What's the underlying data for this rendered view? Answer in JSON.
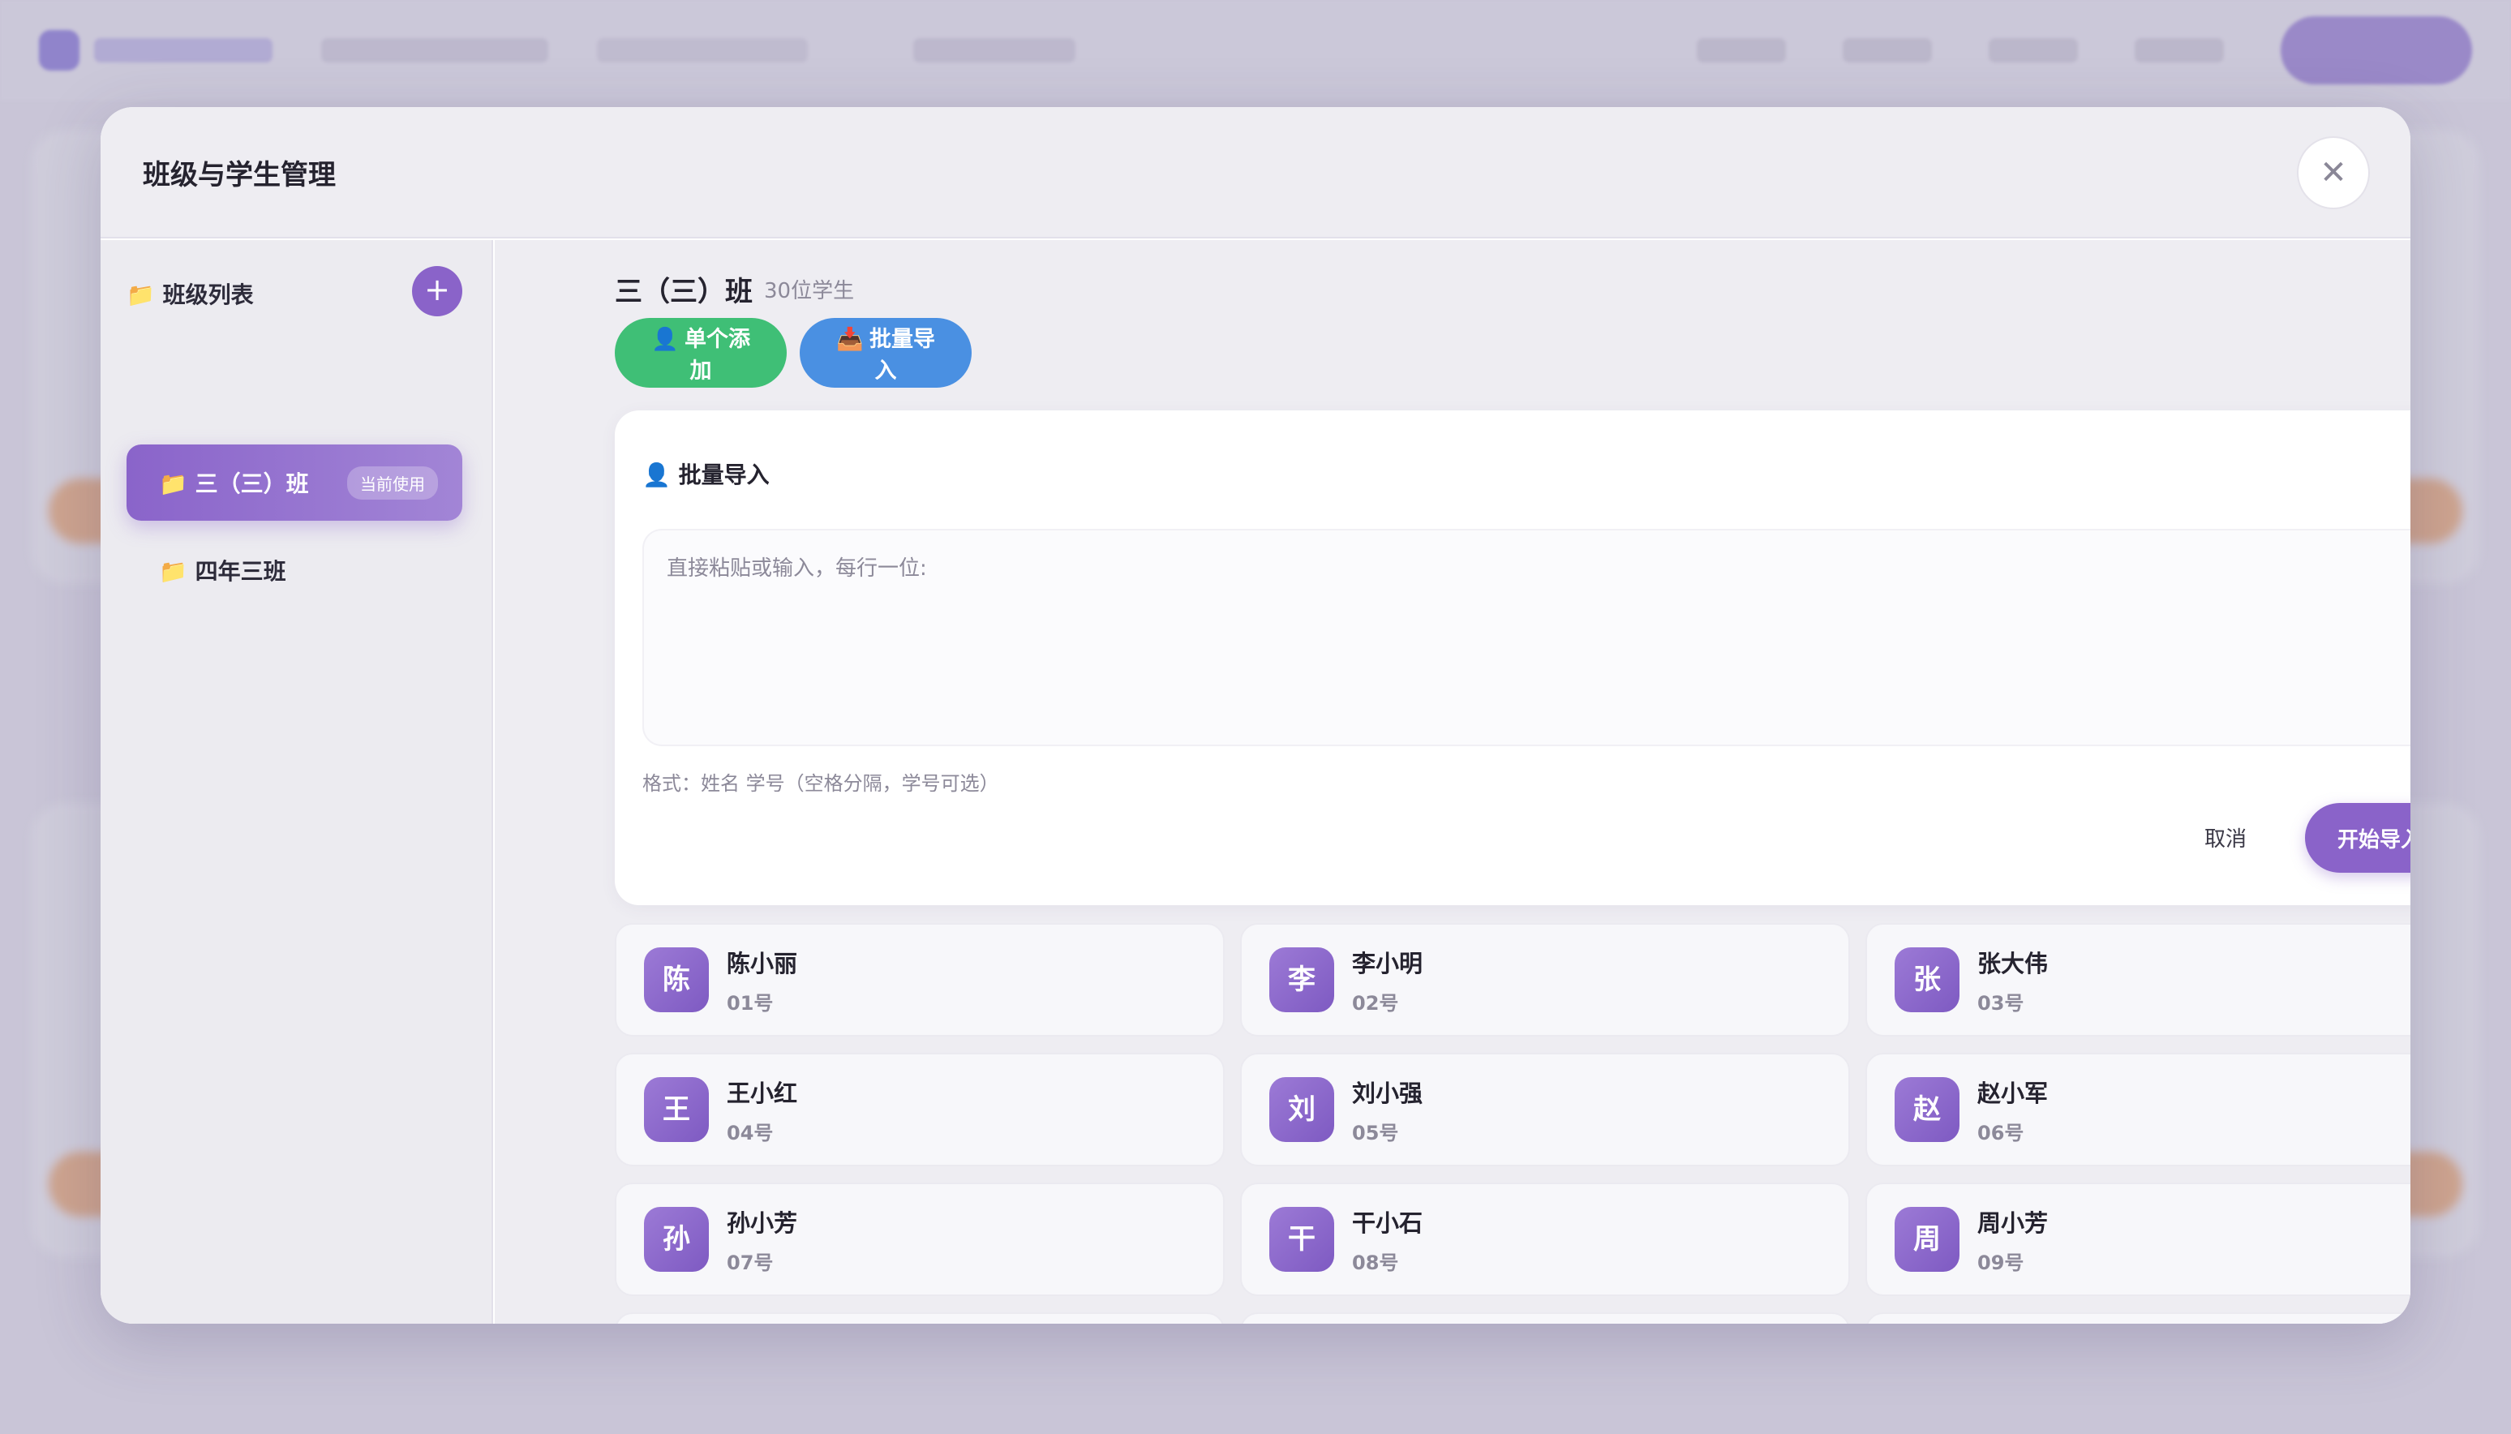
{
  "modal": {
    "title": "班级与学生管理",
    "close_symbol": "✕"
  },
  "sidebar": {
    "header": "📁 班级列表",
    "add_symbol": "+",
    "classes": [
      {
        "label": "📁 三（三）班",
        "badge": "当前使用",
        "active": true
      },
      {
        "label": "📁 四年三班",
        "badge": "",
        "active": false
      }
    ]
  },
  "main": {
    "class_name": "三（三）班",
    "student_count": "30位学生",
    "btn_single": "👤 单个添加",
    "btn_batch": "📥 批量导入"
  },
  "import_panel": {
    "title": "👤 批量导入",
    "close_symbol": "✕",
    "placeholder": "直接粘贴或输入，每行一位:",
    "value": "",
    "hint": "格式：姓名 学号（空格分隔，学号可选）",
    "cancel": "取消",
    "start": "开始导入"
  },
  "students": [
    {
      "initial": "陈",
      "name": "陈小丽",
      "number": "01号"
    },
    {
      "initial": "李",
      "name": "李小明",
      "number": "02号"
    },
    {
      "initial": "张",
      "name": "张大伟",
      "number": "03号"
    },
    {
      "initial": "王",
      "name": "王小红",
      "number": "04号"
    },
    {
      "initial": "刘",
      "name": "刘小强",
      "number": "05号"
    },
    {
      "initial": "赵",
      "name": "赵小军",
      "number": "06号"
    },
    {
      "initial": "孙",
      "name": "孙小芳",
      "number": "07号"
    },
    {
      "initial": "干",
      "name": "干小石",
      "number": "08号"
    },
    {
      "initial": "周",
      "name": "周小芳",
      "number": "09号"
    },
    {
      "initial": "",
      "name": "",
      "number": ""
    },
    {
      "initial": "",
      "name": "",
      "number": ""
    },
    {
      "initial": "",
      "name": "",
      "number": ""
    }
  ],
  "colors": {
    "accent": "#8a63c9",
    "green": "#3fbf76",
    "blue": "#4a90e2"
  }
}
